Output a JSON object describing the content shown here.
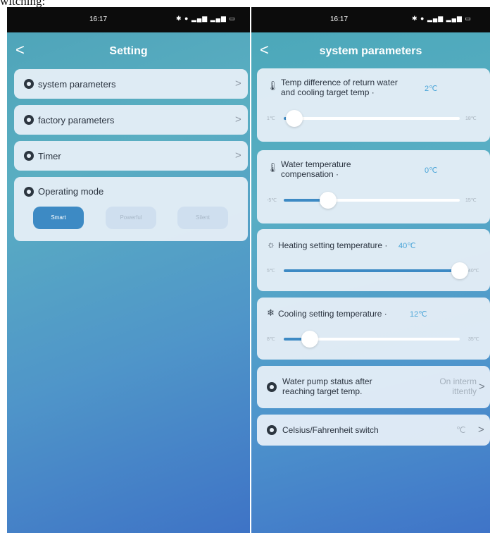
{
  "caption": "witching:",
  "left_screen": {
    "status": {
      "time": "16:17",
      "icons": "✱ ● ▂▄▆ ▂▄▆ ▭"
    },
    "back_symbol": "<",
    "title": "Setting",
    "items": [
      {
        "label": "system parameters",
        "chevron": ">"
      },
      {
        "label": "factory parameters",
        "chevron": ">"
      },
      {
        "label": "Timer",
        "chevron": ">"
      }
    ],
    "operating_mode": {
      "label": "Operating mode",
      "options": [
        "Smart",
        "Powerful",
        "Silent"
      ],
      "selected": "Smart"
    }
  },
  "right_screen": {
    "status": {
      "time": "16:17",
      "icons": "✱ ● ▂▄▆ ▂▄▆ ▭"
    },
    "back_symbol": "<",
    "title": "system parameters",
    "sliders": [
      {
        "icon": "thermometer-icon",
        "label_line1": "Temp difference of return water",
        "label_line2": "and cooling target temp ·",
        "value": "2℃",
        "min_label": "1℃",
        "max_label": "18℃",
        "min": 1,
        "max": 18,
        "current": 2
      },
      {
        "icon": "thermometer-icon",
        "label_line1": "Water temperature",
        "label_line2": "compensation ·",
        "value": "0℃",
        "min_label": "-5℃",
        "max_label": "15℃",
        "min": -5,
        "max": 15,
        "current": 0
      },
      {
        "icon": "sun-icon",
        "label_line1": "Heating setting temperature ·",
        "label_line2": "",
        "value": "40℃",
        "min_label": "5℃",
        "max_label": "40℃",
        "min": 5,
        "max": 40,
        "current": 40
      },
      {
        "icon": "snowflake-icon",
        "label_line1": "Cooling setting temperature ·",
        "label_line2": "",
        "value": "12℃",
        "min_label": "8℃",
        "max_label": "35℃",
        "min": 8,
        "max": 35,
        "current": 12
      }
    ],
    "pump_status": {
      "label_line1": "Water pump status after",
      "label_line2": "reaching target temp.",
      "value_line1": "On interm",
      "value_line2": "ittently",
      "chevron": ">"
    },
    "unit_switch": {
      "label": "Celsius/Fahrenheit switch",
      "value": "℃",
      "chevron": ">"
    }
  },
  "colors": {
    "accent": "#3d8ac4",
    "value_text": "#4aa5d8",
    "card_bg": "#e8f0f8"
  }
}
